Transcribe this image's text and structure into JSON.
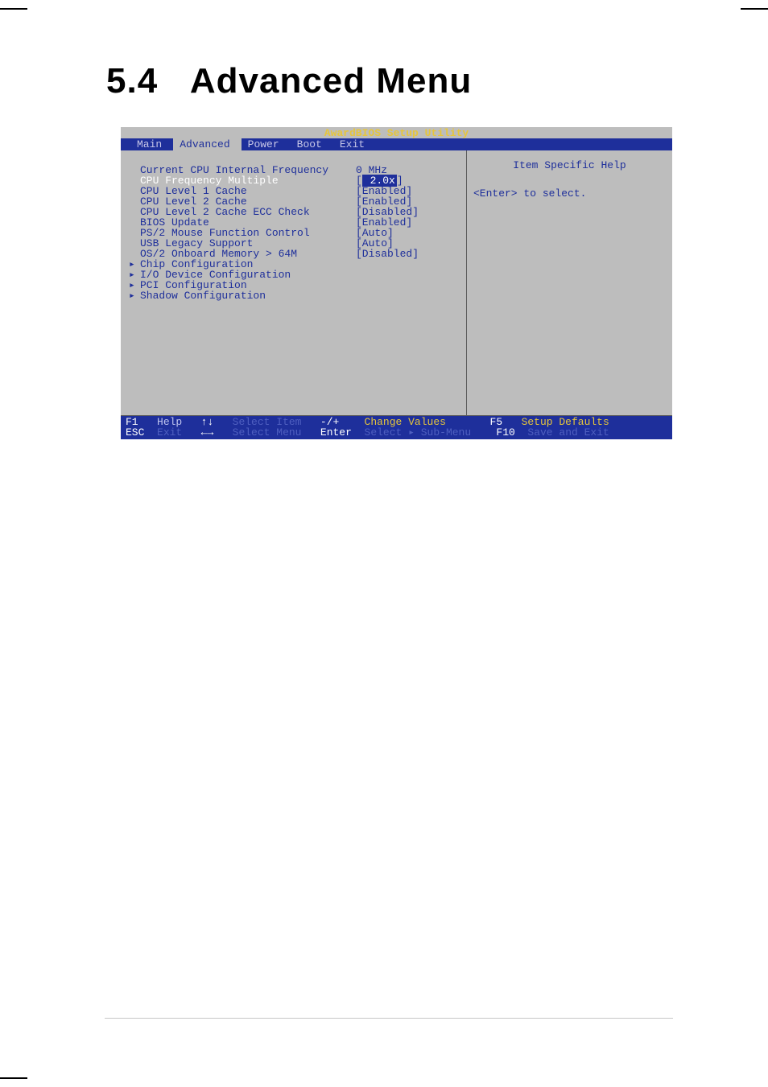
{
  "doc": {
    "section_number": "5.4",
    "section_title": "Advanced Menu"
  },
  "bios": {
    "title": "AwardBIOS Setup Utility",
    "tabs": [
      "Main",
      "Advanced",
      "Power",
      "Boot",
      "Exit"
    ],
    "submenu_glyph": "▸",
    "items": [
      {
        "label": "Current CPU Internal Frequency",
        "value": "0 MHz",
        "submenu": false
      },
      {
        "label": "CPU Frequency Multiple",
        "value": " 2.0x",
        "submenu": false,
        "selected": true
      },
      {
        "label": "CPU Level 1 Cache",
        "value": "[Enabled]",
        "submenu": false
      },
      {
        "label": "CPU Level 2 Cache",
        "value": "[Enabled]",
        "submenu": false
      },
      {
        "label": "CPU Level 2 Cache ECC Check",
        "value": "[Disabled]",
        "submenu": false
      },
      {
        "label": "BIOS Update",
        "value": "[Enabled]",
        "submenu": false
      },
      {
        "label": "PS/2 Mouse Function Control",
        "value": "[Auto]",
        "submenu": false
      },
      {
        "label": "USB Legacy Support",
        "value": "[Auto]",
        "submenu": false
      },
      {
        "label": "OS/2 Onboard Memory > 64M",
        "value": "[Disabled]",
        "submenu": false
      },
      {
        "label": "Chip Configuration",
        "value": "",
        "submenu": true
      },
      {
        "label": "I/O Device Configuration",
        "value": "",
        "submenu": true
      },
      {
        "label": "PCI Configuration",
        "value": "",
        "submenu": true
      },
      {
        "label": "Shadow Configuration",
        "value": "",
        "submenu": true
      }
    ],
    "help": {
      "title": "Item Specific Help",
      "text": "<Enter> to select."
    },
    "footer": {
      "f1_key": "F1",
      "f1_label": "Help",
      "updown": "↑↓",
      "select_item": "Select Item",
      "plusminus": "-/+",
      "change_values": "Change Values",
      "f5_key": "F5",
      "f5_label": "Setup Defaults",
      "esc_key": "ESC",
      "esc_label": "Exit",
      "leftright": "←→",
      "select_menu": "Select Menu",
      "enter": "Enter",
      "select_submenu": "Select ▸ Sub-Menu",
      "f10_key": "F10",
      "f10_label": "Save and Exit"
    }
  }
}
